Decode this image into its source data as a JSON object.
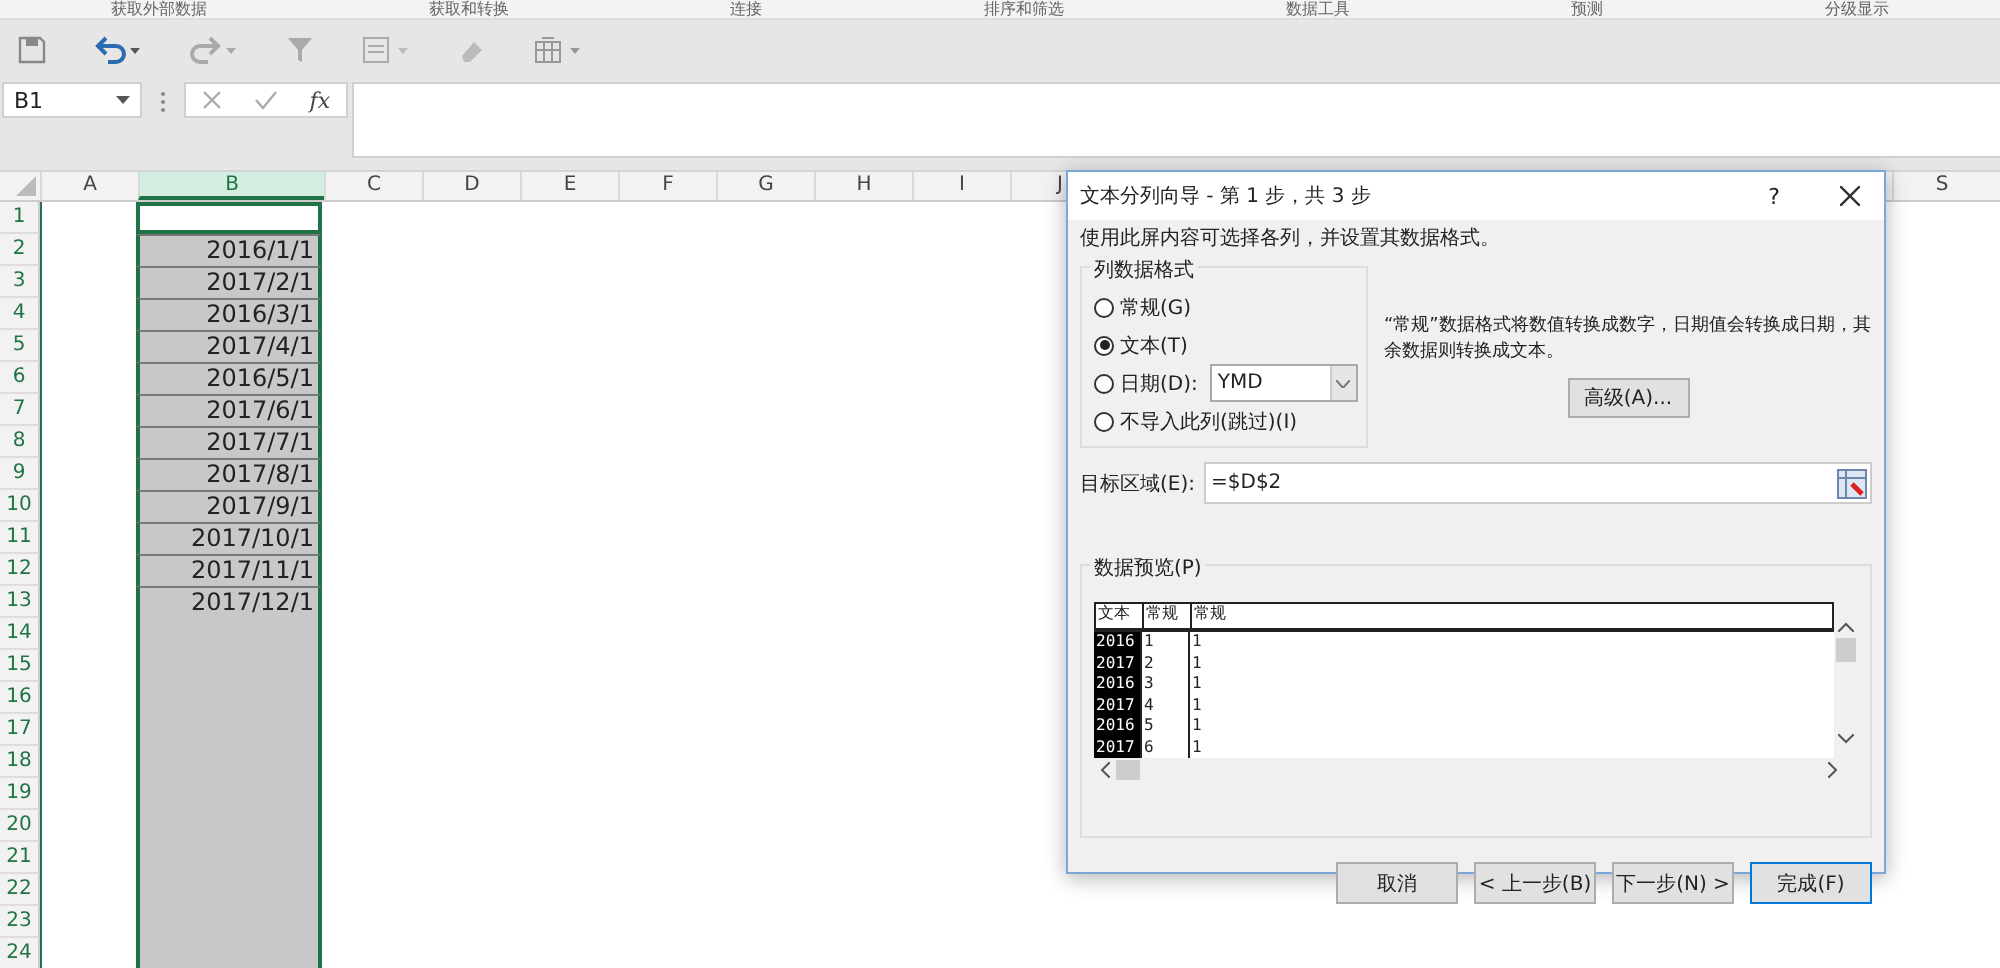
{
  "ribbon_groups": [
    "获取外部数据",
    "获取和转换",
    "连接",
    "排序和筛选",
    "数据工具",
    "预测",
    "分级显示"
  ],
  "name_box": {
    "value": "B1"
  },
  "formula_bar": {
    "fx": "fx"
  },
  "sheet": {
    "columns": [
      {
        "label": "A",
        "selected": false
      },
      {
        "label": "B",
        "selected": true
      },
      {
        "label": "C",
        "selected": false
      },
      {
        "label": "D",
        "selected": false
      },
      {
        "label": "E",
        "selected": false
      },
      {
        "label": "F",
        "selected": false
      },
      {
        "label": "G",
        "selected": false
      },
      {
        "label": "H",
        "selected": false
      },
      {
        "label": "I",
        "selected": false
      },
      {
        "label": "J",
        "selected": false
      }
    ],
    "far_column": {
      "label": "S",
      "selected": false
    },
    "rows": [
      {
        "number": "1",
        "selected": false
      },
      {
        "number": "2",
        "selected": true,
        "b": "2016/1/1"
      },
      {
        "number": "3",
        "selected": true,
        "b": "2017/2/1"
      },
      {
        "number": "4",
        "selected": true,
        "b": "2016/3/1"
      },
      {
        "number": "5",
        "selected": true,
        "b": "2017/4/1"
      },
      {
        "number": "6",
        "selected": true,
        "b": "2016/5/1"
      },
      {
        "number": "7",
        "selected": true,
        "b": "2017/6/1"
      },
      {
        "number": "8",
        "selected": true,
        "b": "2017/7/1"
      },
      {
        "number": "9",
        "selected": true,
        "b": "2017/8/1"
      },
      {
        "number": "10",
        "selected": true,
        "b": "2017/9/1"
      },
      {
        "number": "11",
        "selected": true,
        "b": "2017/10/1"
      },
      {
        "number": "12",
        "selected": true,
        "b": "2017/11/1"
      },
      {
        "number": "13",
        "selected": true,
        "b": "2017/12/1"
      },
      {
        "number": "14",
        "selected": true
      },
      {
        "number": "15",
        "selected": true
      },
      {
        "number": "16",
        "selected": true
      },
      {
        "number": "17",
        "selected": true
      },
      {
        "number": "18",
        "selected": true
      },
      {
        "number": "19",
        "selected": true
      },
      {
        "number": "20",
        "selected": true
      },
      {
        "number": "21",
        "selected": true
      },
      {
        "number": "22",
        "selected": true
      },
      {
        "number": "23",
        "selected": true
      },
      {
        "number": "24",
        "selected": true
      }
    ]
  },
  "dialog": {
    "title": "文本分列向导 - 第 1 步，共 3 步",
    "help": "?",
    "intro": "使用此屏内容可选择各列，并设置其数据格式。",
    "format_group": {
      "legend": "列数据格式",
      "options": [
        {
          "label": "常规(G)",
          "selected": false,
          "kind": "plain"
        },
        {
          "label": "文本(T)",
          "selected": true,
          "kind": "plain"
        },
        {
          "label": "日期(D):",
          "selected": false,
          "kind": "date"
        },
        {
          "label": "不导入此列(跳过)(I)",
          "selected": false,
          "kind": "plain"
        }
      ],
      "date_format": "YMD"
    },
    "description": "“常规”数据格式将数值转换成数字，日期值会转换成日期，其余数据则转换成文本。",
    "advanced_button": "高级(A)...",
    "destination": {
      "label": "目标区域(E):",
      "value": "=$D$2"
    },
    "preview": {
      "legend": "数据预览(P)",
      "headers": [
        "文本",
        "常规",
        "常规"
      ],
      "rows": [
        [
          "2016",
          "1",
          "1"
        ],
        [
          "2017",
          "2",
          "1"
        ],
        [
          "2016",
          "3",
          "1"
        ],
        [
          "2017",
          "4",
          "1"
        ],
        [
          "2016",
          "5",
          "1"
        ],
        [
          "2017",
          "6",
          "1"
        ]
      ]
    },
    "buttons": [
      {
        "label": "取消",
        "default": false
      },
      {
        "label": "< 上一步(B)",
        "default": false
      },
      {
        "label": "下一步(N) >",
        "default": false
      },
      {
        "label": "完成(F)",
        "default": true
      }
    ]
  }
}
